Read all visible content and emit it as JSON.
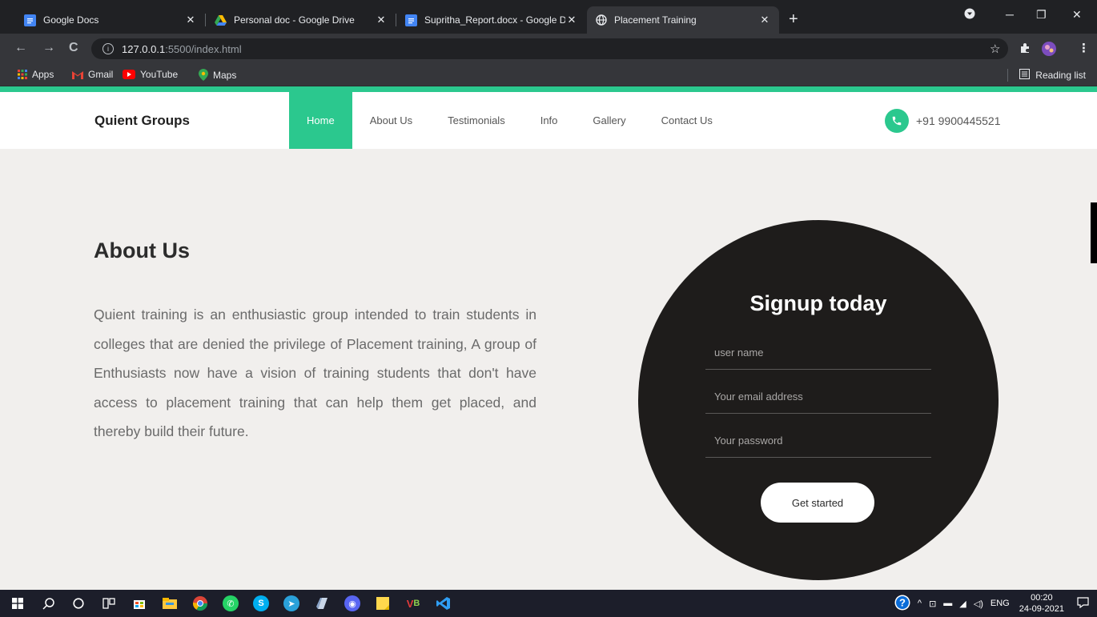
{
  "browser": {
    "tabs": [
      {
        "title": "Google Docs",
        "icon": "google-docs-icon"
      },
      {
        "title": "Personal doc - Google Drive",
        "icon": "google-drive-icon"
      },
      {
        "title": "Supritha_Report.docx - Google D",
        "icon": "google-docs-icon"
      },
      {
        "title": "Placement Training",
        "icon": "globe-icon"
      }
    ],
    "url_host": "127.0.0.1",
    "url_path": ":5500/index.html",
    "bookmarks": [
      "Apps",
      "Gmail",
      "YouTube",
      "Maps"
    ],
    "reading_list": "Reading list"
  },
  "site": {
    "brand": "Quient Groups",
    "menu": [
      "Home",
      "About Us",
      "Testimonials",
      "Info",
      "Gallery",
      "Contact Us"
    ],
    "phone": "+91 9900445521",
    "accent_color": "#2bc88e"
  },
  "about": {
    "title": "About Us",
    "text": "Quient training is an enthusiastic group intended to train students in colleges that are denied the privilege of Placement training, A group of Enthusiasts now have a vision of training students that don't have access to placement training that can help them get placed, and thereby build their future."
  },
  "signup": {
    "title": "Signup today",
    "username_placeholder": "user name",
    "email_placeholder": "Your email address",
    "password_placeholder": "Your password",
    "button": "Get started"
  },
  "taskbar": {
    "lang": "ENG",
    "time": "00:20",
    "date": "24-09-2021"
  }
}
